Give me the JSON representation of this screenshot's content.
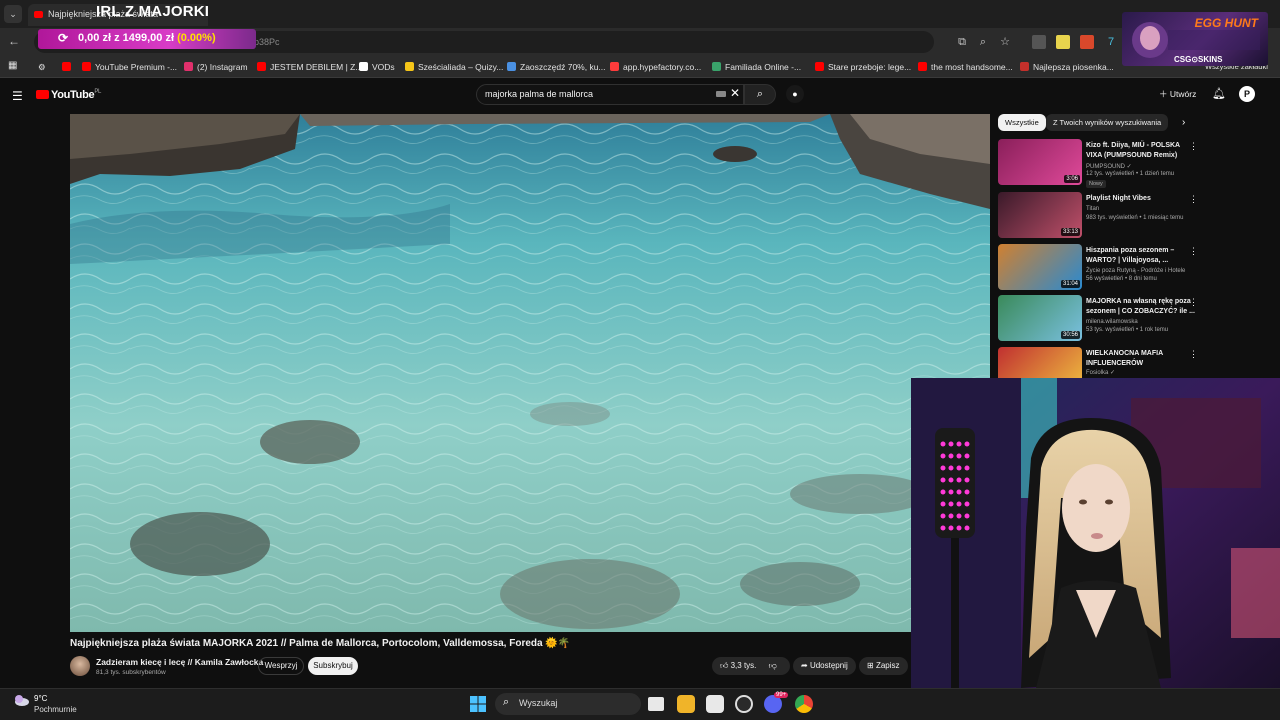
{
  "browser": {
    "tab_title": "Najpiękniejsza plaża świata",
    "url_fragment": "p38Pc",
    "bookmarks": [
      {
        "label": "YouTube Premium -...",
        "color": "#ff0000"
      },
      {
        "label": "(2) Instagram",
        "color": "#e1306c"
      },
      {
        "label": "JESTEM DEBILEM | Z...",
        "color": "#ff0000"
      },
      {
        "label": "VODs",
        "color": "#ffffff"
      },
      {
        "label": "Sześcialiada – Quizy...",
        "color": "#f5c518"
      },
      {
        "label": "Zaoszczędź 70%, ku...",
        "color": "#4a90e2"
      },
      {
        "label": "app.hypefactory.co...",
        "color": "#ff3b3b"
      },
      {
        "label": "Familiada Online -...",
        "color": "#3aa36b"
      },
      {
        "label": "Stare przeboje: lege...",
        "color": "#ff0000"
      },
      {
        "label": "the most handsome...",
        "color": "#ff0000"
      },
      {
        "label": "Najlepsza piosenka...",
        "color": "#c4302b"
      }
    ],
    "all_bookmarks_label": "Wszystkie zakładki"
  },
  "overlay": {
    "stream_title": "IRL Z MAJORKI",
    "donation": {
      "current": "0,00 zł",
      "separator": "z",
      "goal": "1499,00 zł",
      "percent": "(0.00%)"
    },
    "egg_hunt_title": "EGG HUNT",
    "egg_hunt_sponsor": "CSG⊙SKINS"
  },
  "youtube": {
    "logo_text": "YouTube",
    "region": "PL",
    "search_query": "majorka palma de mallorca",
    "create_label": "Utwórz",
    "avatar_letter": "P",
    "video": {
      "title": "Najpiękniejsza plaża świata MAJORKA 2021 // Palma de Mallorca, Portocolom, Valldemossa, Foreda 🌞🌴",
      "channel": "Zadzieram kiecę i lecę // Kamila Zawłocka",
      "subscribers": "81,3 tys. subskrybentów",
      "support_label": "Wesprzyj",
      "subscribe_label": "Subskrybuj",
      "likes": "3,3 tys.",
      "share_label": "Udostępnij",
      "save_label": "Zapisz"
    },
    "chips": [
      "Wszystkie",
      "Z Twoich wyników wyszukiwania"
    ],
    "recommendations": [
      {
        "title": "Kizo ft. Diiya, MIÜ - POLSKA VIXA (PUMPSOUND Remix)",
        "channel": "PUMPSOUND ✓",
        "meta": "12 tys. wyświetleń • 1 dzień temu",
        "badge": "Nowy",
        "duration": "3:06",
        "c1": "#8a1f5a",
        "c2": "#e04a9a"
      },
      {
        "title": "Playlist Night Vibes",
        "channel": "Titan",
        "meta": "983 tys. wyświetleń • 1 miesiąc temu",
        "badge": "",
        "duration": "33:13",
        "c1": "#3a1a2a",
        "c2": "#c0506a"
      },
      {
        "title": "Hiszpania poza sezonem – WARTO? | Villajoyosa, ...",
        "channel": "Życie poza Rutyną - Podróże i Hotele",
        "meta": "56 wyświetleń • 8 dni temu",
        "badge": "",
        "duration": "31:04",
        "c1": "#d08030",
        "c2": "#2a8ad0"
      },
      {
        "title": "MAJORKA na własną rękę poza sezonem | CO ZOBACZYĆ? ile ...",
        "channel": "milena.wilamowska",
        "meta": "53 tys. wyświetleń • 1 rok temu",
        "badge": "",
        "duration": "30:56",
        "c1": "#3a8a5a",
        "c2": "#7ac0e0"
      },
      {
        "title": "WIELKANOCNA MAFIA INFLUENCERÓW",
        "channel": "Fosiolka ✓",
        "meta": "",
        "badge": "",
        "duration": "",
        "c1": "#c03030",
        "c2": "#f0c040"
      }
    ]
  },
  "taskbar": {
    "temperature": "9°C",
    "weather": "Pochmurnie",
    "search_placeholder": "Wyszukaj",
    "badge_count": "99+"
  }
}
